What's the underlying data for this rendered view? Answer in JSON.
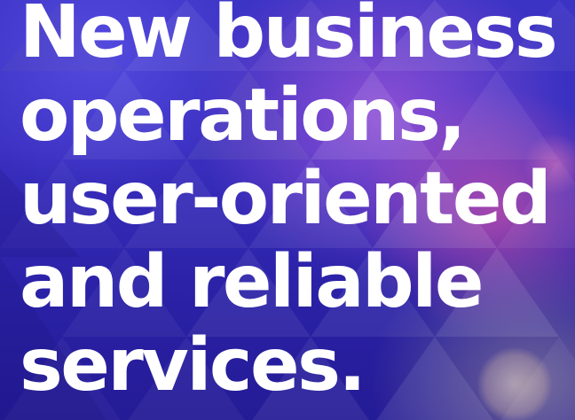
{
  "hero": {
    "headline_lines": [
      "New business",
      "operations,",
      "user-oriented",
      "and reliable",
      "services."
    ]
  },
  "colors": {
    "background_primary": "#3a2fc0",
    "background_dark": "#241b96",
    "accent_purple": "#a55adc",
    "accent_magenta": "#c850aa",
    "text": "#ffffff"
  }
}
